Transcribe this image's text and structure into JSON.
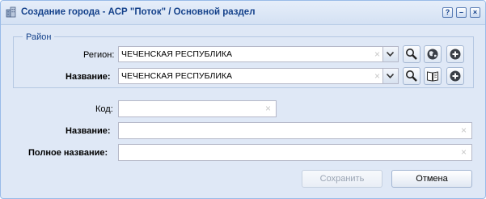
{
  "window": {
    "title": "Создание города - АСР \"Поток\" / Основной раздел",
    "help_label": "?",
    "minimize_label": "–",
    "close_label": "×"
  },
  "district": {
    "legend": "Район",
    "region_label": "Регион:",
    "region_value": "ЧЕЧЕНСКАЯ РЕСПУБЛИКА",
    "name_label": "Название:",
    "name_value": "ЧЕЧЕНСКАЯ РЕСПУБЛИКА"
  },
  "form": {
    "code_label": "Код:",
    "code_value": "",
    "name_label": "Название:",
    "name_value": "",
    "fullname_label": "Полное название:",
    "fullname_value": ""
  },
  "buttons": {
    "save_label": "Сохранить",
    "cancel_label": "Отмена"
  },
  "icons": {
    "window": "city-icon",
    "search": "search-icon",
    "globe": "globe-icon",
    "add": "add-icon",
    "book": "book-icon",
    "dropdown": "chevron-down-icon",
    "clear": "clear-icon"
  },
  "colors": {
    "title": "#15428b",
    "window_bg": "#dfe8f6",
    "border": "#99bbe8"
  }
}
